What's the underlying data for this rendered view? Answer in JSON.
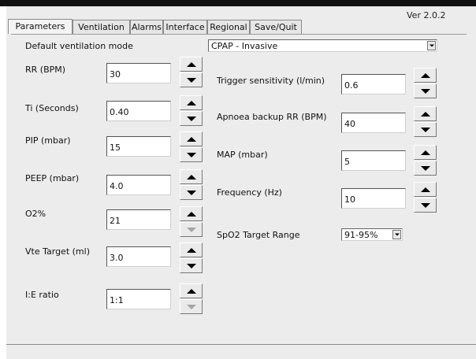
{
  "header": {
    "version": "Ver 2.0.2"
  },
  "tabs": [
    {
      "label": "Parameters",
      "active": true
    },
    {
      "label": "Ventilation",
      "active": false
    },
    {
      "label": "Alarms",
      "active": false
    },
    {
      "label": "Interface",
      "active": false
    },
    {
      "label": "Regional",
      "active": false
    },
    {
      "label": "Save/Quit",
      "active": false
    }
  ],
  "mode": {
    "label": "Default ventilation mode",
    "value": "CPAP - Invasive"
  },
  "left_params": [
    {
      "label": "RR (BPM)",
      "value": "30",
      "down_enabled": true
    },
    {
      "label": "Ti (Seconds)",
      "value": "0.40",
      "down_enabled": true
    },
    {
      "label": "PIP (mbar)",
      "value": "15",
      "down_enabled": true
    },
    {
      "label": "PEEP (mbar)",
      "value": "4.0",
      "down_enabled": true
    },
    {
      "label": "O2%",
      "value": "21",
      "down_enabled": false
    },
    {
      "label": "Vte Target (ml)",
      "value": "3.0",
      "down_enabled": true
    },
    {
      "label": "I:E ratio",
      "value": "1:1",
      "down_enabled": false
    }
  ],
  "right_params": [
    {
      "label": "Trigger sensitivity (l/min)",
      "value": "0.6"
    },
    {
      "label": "Apnoea backup RR (BPM)",
      "value": "40"
    },
    {
      "label": "MAP (mbar)",
      "value": "5"
    },
    {
      "label": "Frequency (Hz)",
      "value": "10"
    }
  ],
  "spo2": {
    "label": "SpO2 Target Range",
    "value": "91-95%"
  },
  "icons": {
    "up": "arrow-up-icon",
    "down": "arrow-down-icon",
    "dropdown": "chevron-down-icon"
  }
}
